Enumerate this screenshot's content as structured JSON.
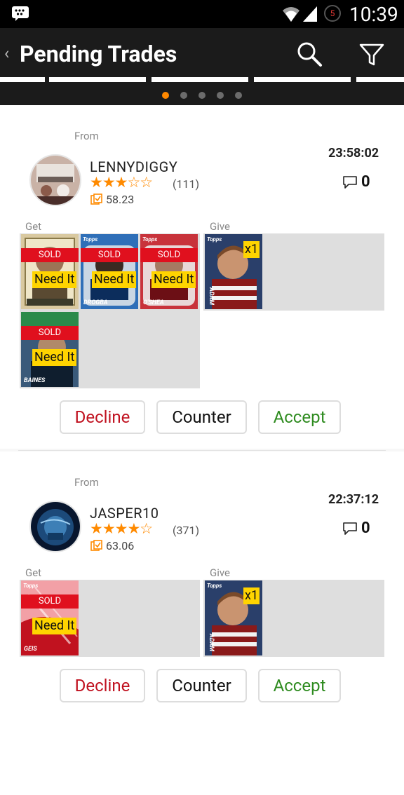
{
  "status_bar": {
    "time": "10:39",
    "notification_count": "5"
  },
  "action_bar": {
    "back_glyph": "‹",
    "title": "Pending Trades",
    "search_icon": "search-icon",
    "filter_icon": "filter-icon"
  },
  "pager": {
    "pages": 5,
    "active": 0
  },
  "trades": [
    {
      "from_label": "From",
      "username": "LENNYDIGGY",
      "stars": "★★★☆☆",
      "rating_count": "(111)",
      "score": "58.23",
      "timestamp": "23:58:02",
      "comments": "0",
      "get_label": "Get",
      "give_label": "Give",
      "get_cards": [
        {
          "sold": "SOLD",
          "need": "Need It",
          "name": "",
          "colors": [
            "#d9c9a0",
            "#5a4a32"
          ]
        },
        {
          "sold": "SOLD",
          "need": "Need It",
          "name": "DROGBA",
          "colors": [
            "#2f6fb8",
            "#0c2d5c"
          ]
        },
        {
          "sold": "SOLD",
          "need": "Need It",
          "name": "O'SHEA",
          "colors": [
            "#c8333b",
            "#6c0f15"
          ]
        },
        {
          "sold": "SOLD",
          "need": "Need It",
          "name": "BAINES",
          "colors": [
            "#3a5a7a",
            "#0f1e2e"
          ]
        }
      ],
      "give_cards": [
        {
          "count": "x1",
          "name": "ADAM",
          "colors": [
            "#2a3f6a",
            "#8a1a1a"
          ]
        }
      ],
      "decline": "Decline",
      "counter": "Counter",
      "accept": "Accept"
    },
    {
      "from_label": "From",
      "username": "JASPER10",
      "stars": "★★★★☆",
      "rating_count": "(371)",
      "score": "63.06",
      "timestamp": "22:37:12",
      "comments": "0",
      "get_label": "Get",
      "give_label": "Give",
      "get_cards": [
        {
          "sold": "SOLD",
          "need": "Need It",
          "name": "GEIS",
          "colors": [
            "#f2a0a6",
            "#c1121f"
          ]
        }
      ],
      "give_cards": [
        {
          "count": "x1",
          "name": "ADAM",
          "colors": [
            "#2a3f6a",
            "#8a1a1a"
          ]
        }
      ],
      "decline": "Decline",
      "counter": "Counter",
      "accept": "Accept"
    }
  ],
  "colors": {
    "accent": "#ff8800",
    "decline": "#c0111f",
    "accept": "#2e8b1f",
    "sold": "#e0101e",
    "need": "#ffd400"
  }
}
